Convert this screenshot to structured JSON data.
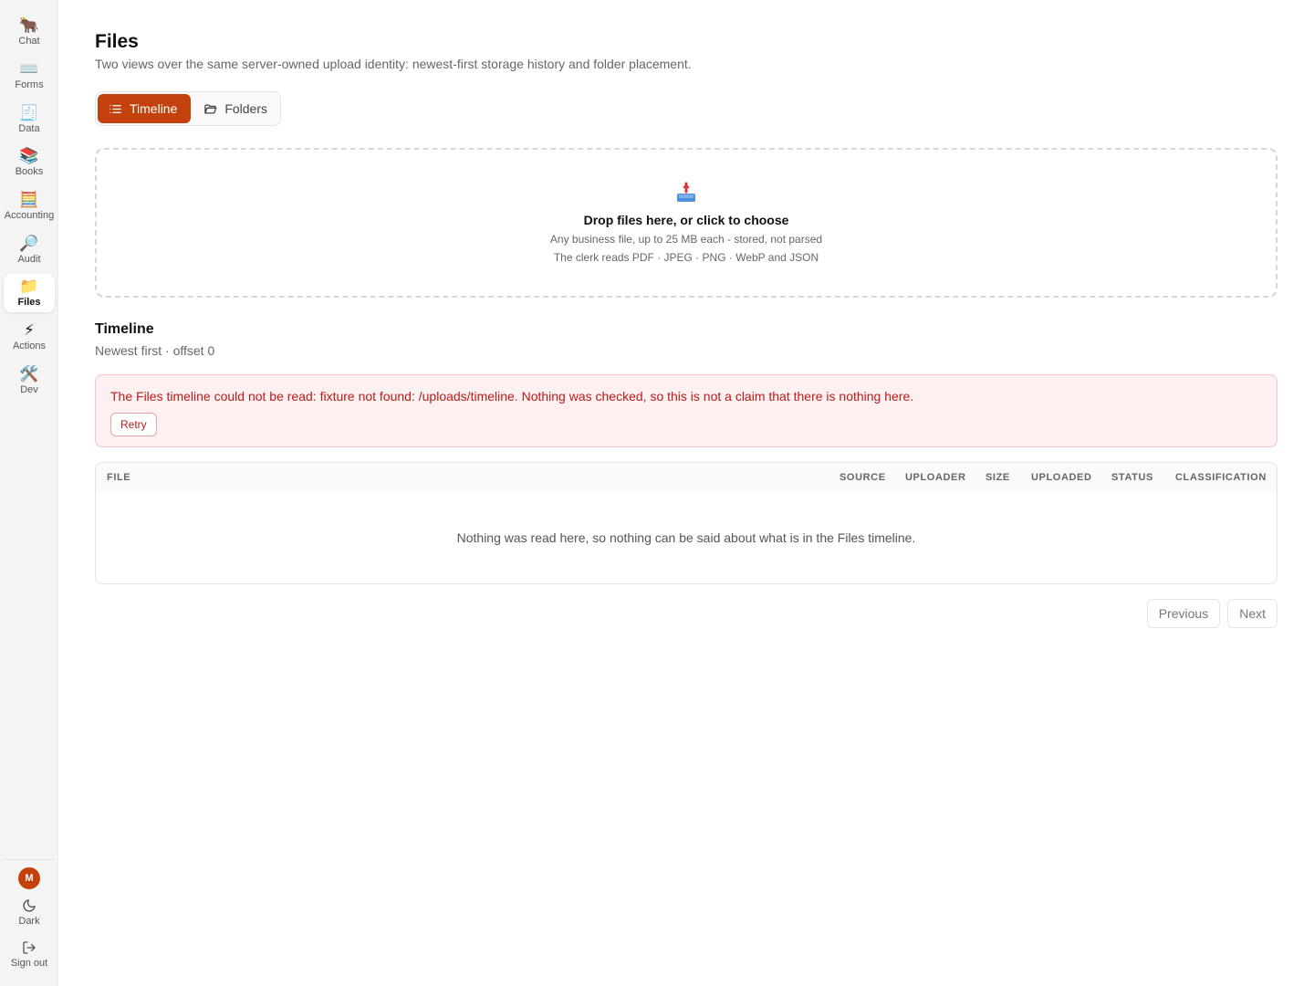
{
  "sidebar": {
    "items": [
      {
        "label": "Chat",
        "icon": "🐂",
        "icon_name": "ox-icon"
      },
      {
        "label": "Forms",
        "icon": "⌨️",
        "icon_name": "keyboard-icon"
      },
      {
        "label": "Data",
        "icon": "🧾",
        "icon_name": "receipt-icon"
      },
      {
        "label": "Books",
        "icon": "📚",
        "icon_name": "books-icon"
      },
      {
        "label": "Accounting",
        "icon": "🧮",
        "icon_name": "abacus-icon"
      },
      {
        "label": "Audit",
        "icon": "🔎",
        "icon_name": "magnifier-icon"
      },
      {
        "label": "Files",
        "icon": "📁",
        "icon_name": "folder-icon"
      },
      {
        "label": "Actions",
        "icon": "⚡",
        "icon_name": "lightning-icon"
      },
      {
        "label": "Dev",
        "icon": "🛠️",
        "icon_name": "tools-icon"
      }
    ],
    "active": "Files",
    "avatar_initial": "M",
    "theme_label": "Dark",
    "signout_label": "Sign out"
  },
  "page": {
    "title": "Files",
    "subtitle": "Two views over the same server-owned upload identity: newest-first storage history and folder placement."
  },
  "view_toggle": {
    "timeline_label": "Timeline",
    "folders_label": "Folders",
    "active": "Timeline"
  },
  "dropzone": {
    "title": "Drop files here, or click to choose",
    "line1": "Any business file, up to 25 MB each - stored, not parsed",
    "line2": "The clerk reads PDF · JPEG · PNG · WebP and JSON"
  },
  "timeline": {
    "title": "Timeline",
    "subtitle": "Newest first · offset 0"
  },
  "error": {
    "message": "The Files timeline could not be read: fixture not found: /uploads/timeline. Nothing was checked, so this is not a claim that there is nothing here.",
    "retry_label": "Retry"
  },
  "table": {
    "columns": [
      "FILE",
      "SOURCE",
      "UPLOADER",
      "SIZE",
      "UPLOADED",
      "STATUS",
      "CLASSIFICATION"
    ],
    "empty_message": "Nothing was read here, so nothing can be said about what is in the Files timeline."
  },
  "pager": {
    "previous_label": "Previous",
    "next_label": "Next"
  },
  "colors": {
    "accent": "#c2410c",
    "error_text": "#b91c1c",
    "error_bg": "#fdf0f0"
  }
}
